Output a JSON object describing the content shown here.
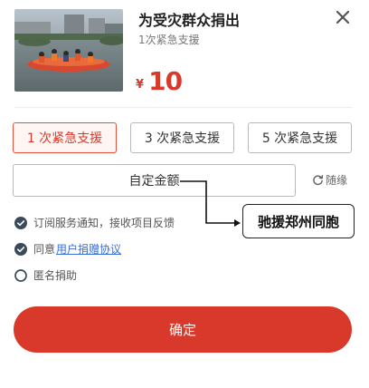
{
  "header": {
    "title": "为受灾群众捐出",
    "subtitle": "1次紧急支援",
    "currency": "¥",
    "amount": "10"
  },
  "options": [
    {
      "label": "1 次紧急支援",
      "selected": true
    },
    {
      "label": "3 次紧急支援",
      "selected": false
    },
    {
      "label": "5 次紧急支援",
      "selected": false
    }
  ],
  "custom": {
    "label": "自定金额",
    "random_label": "随缘"
  },
  "callout": {
    "text": "驰援郑州同胞"
  },
  "agreements": {
    "notify": {
      "label": "订阅服务通知，接收项目反馈",
      "checked": true
    },
    "agree": {
      "prefix": "同意",
      "link": "用户捐赠协议",
      "checked": true
    },
    "anonymous": {
      "label": "匿名捐助",
      "checked": false
    }
  },
  "confirm_label": "确定",
  "colors": {
    "accent": "#d8392b",
    "selected_border": "#e0523e",
    "link": "#3a6fd8",
    "check_fill": "#3b4a5a"
  },
  "icons": {
    "close": "close-icon",
    "refresh": "refresh-icon",
    "check": "check-circle-icon",
    "radio": "radio-empty-icon"
  }
}
